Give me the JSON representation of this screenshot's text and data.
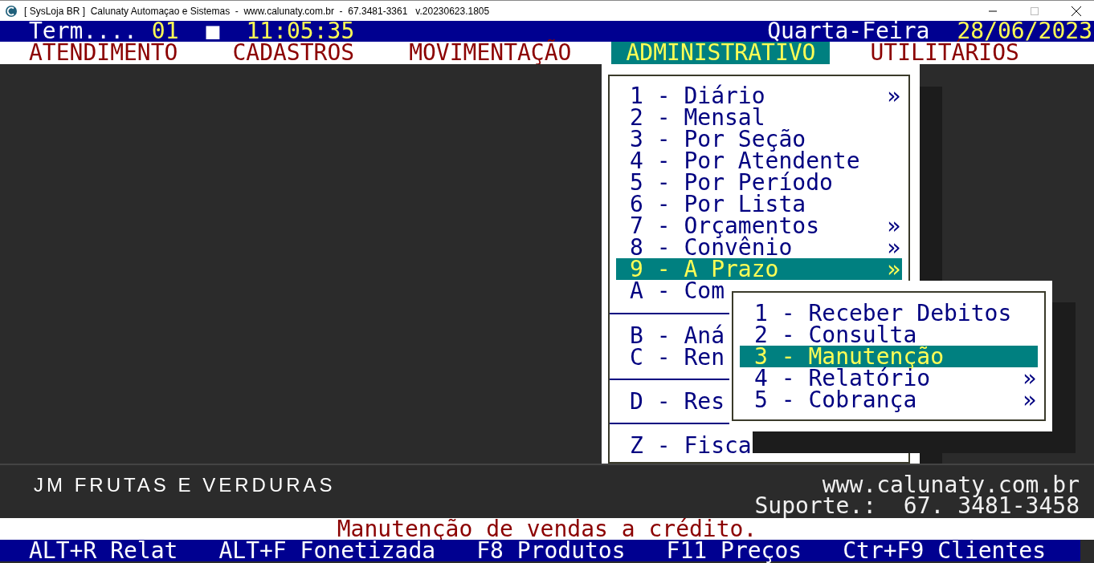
{
  "window": {
    "title": "[ SysLoja BR ]  Calunaty Automaçao e Sistemas  -  www.calunaty.com.br  -  67.3481-3361   v.20230623.1805"
  },
  "header": {
    "terminal_label": "Term....",
    "terminal": "01",
    "marker": "■",
    "time": "11:05:35",
    "weekday": "Quarta-Feira",
    "date": "28/06/2023"
  },
  "menu_bar": [
    {
      "label": "ATENDIMENTO",
      "selected": false
    },
    {
      "label": "CADASTROS",
      "selected": false
    },
    {
      "label": "MOVIMENTAÇÃO",
      "selected": false
    },
    {
      "label": "ADMINISTRATIVO",
      "selected": true
    },
    {
      "label": "UTILITÁRIOS",
      "selected": false
    }
  ],
  "dropdown": {
    "groups": [
      {
        "items": [
          {
            "text": "1 - Diário",
            "arrow": "»",
            "selected": false
          },
          {
            "text": "2 - Mensal",
            "selected": false
          },
          {
            "text": "3 - Por Seção",
            "selected": false
          },
          {
            "text": "4 - Por Atendente",
            "selected": false
          },
          {
            "text": "5 - Por Período",
            "selected": false
          },
          {
            "text": "6 - Por Lista",
            "selected": false
          },
          {
            "text": "7 - Orçamentos",
            "arrow": "»",
            "selected": false
          },
          {
            "text": "8 - Convênio",
            "arrow": "»",
            "selected": false
          },
          {
            "text": "9 - A Prazo",
            "arrow": "»",
            "selected": true
          },
          {
            "text": "A - Com",
            "selected": false
          }
        ]
      },
      {
        "items": [
          {
            "text": "B - Aná",
            "selected": false
          },
          {
            "text": "C - Ren",
            "selected": false
          }
        ]
      },
      {
        "items": [
          {
            "text": "D - Res",
            "selected": false
          }
        ]
      },
      {
        "items": [
          {
            "text": "Z - Fisca",
            "selected": false
          }
        ]
      }
    ]
  },
  "submenu": {
    "items": [
      {
        "text": "1 - Receber Debitos",
        "selected": false
      },
      {
        "text": "2 - Consulta",
        "selected": false
      },
      {
        "text": "3 - Manutenção",
        "selected": true
      },
      {
        "text": "4 - Relatório",
        "arrow": "»",
        "selected": false
      },
      {
        "text": "5 - Cobrança",
        "arrow": "»",
        "selected": false
      }
    ]
  },
  "footer": {
    "company": "JM FRUTAS E VERDURAS",
    "website": "www.calunaty.com.br",
    "support": "Suporte.:  67. 3481-3458"
  },
  "status_bar": {
    "message": "Manutenção de vendas a crédito."
  },
  "function_keys": [
    "ALT+R Relat",
    "ALT+F Fonetizada",
    "F8 Produtos",
    "F11 Preços",
    "Ctr+F9 Clientes"
  ]
}
